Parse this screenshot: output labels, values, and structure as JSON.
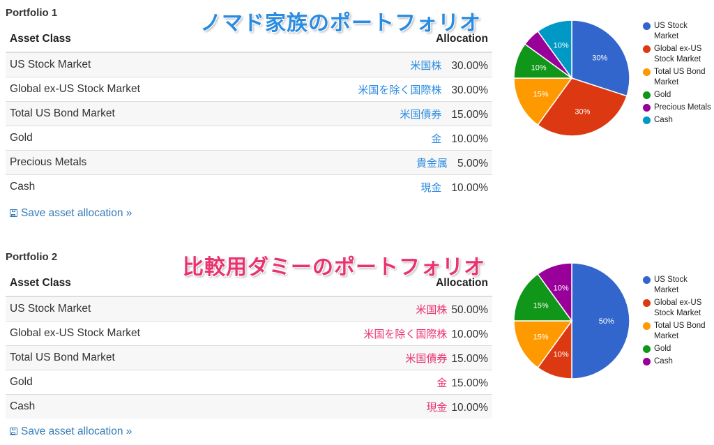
{
  "portfolios": [
    {
      "title": "Portfolio 1",
      "overlay_title": "ノマド家族のポートフォリオ",
      "overlay_color": "#2a8be0",
      "headers": {
        "asset_class": "Asset Class",
        "allocation": "Allocation"
      },
      "rows": [
        {
          "asset": "US Stock Market",
          "jp": "米国株",
          "allocation": "30.00%"
        },
        {
          "asset": "Global ex-US Stock Market",
          "jp": "米国を除く国際株",
          "allocation": "30.00%"
        },
        {
          "asset": "Total US Bond Market",
          "jp": "米国債券",
          "allocation": "15.00%"
        },
        {
          "asset": "Gold",
          "jp": "金",
          "allocation": "10.00%"
        },
        {
          "asset": "Precious Metals",
          "jp": "貴金属",
          "allocation": "5.00%"
        },
        {
          "asset": "Cash",
          "jp": "現金",
          "allocation": "10.00%"
        }
      ],
      "save_label": "Save asset allocation »",
      "save_icon": "floppy-disk-icon"
    },
    {
      "title": "Portfolio 2",
      "overlay_title": "比較用ダミーのポートフォリオ",
      "overlay_color": "#e8336f",
      "headers": {
        "asset_class": "Asset Class",
        "allocation": "Allocation"
      },
      "rows": [
        {
          "asset": "US Stock Market",
          "jp": "米国株",
          "allocation": "50.00%"
        },
        {
          "asset": "Global ex-US Stock Market",
          "jp": "米国を除く国際株",
          "allocation": "10.00%"
        },
        {
          "asset": "Total US Bond Market",
          "jp": "米国債券",
          "allocation": "15.00%"
        },
        {
          "asset": "Gold",
          "jp": "金",
          "allocation": "15.00%"
        },
        {
          "asset": "Cash",
          "jp": "現金",
          "allocation": "10.00%"
        }
      ],
      "save_label": "Save asset allocation »",
      "save_icon": "floppy-disk-icon"
    }
  ],
  "chart_data": [
    {
      "type": "pie",
      "title": "Portfolio 1",
      "legend_position": "right",
      "categories": [
        "US Stock Market",
        "Global ex-US Stock Market",
        "Total US Bond Market",
        "Gold",
        "Precious Metals",
        "Cash"
      ],
      "values": [
        30,
        30,
        15,
        10,
        5,
        10
      ],
      "labels": [
        "30%",
        "30%",
        "15%",
        "10%",
        "",
        "10%"
      ],
      "colors": [
        "#3366cc",
        "#dc3912",
        "#ff9900",
        "#109618",
        "#990099",
        "#0099c6"
      ]
    },
    {
      "type": "pie",
      "title": "Portfolio 2",
      "legend_position": "right",
      "categories": [
        "US Stock Market",
        "Global ex-US Stock Market",
        "Total US Bond Market",
        "Gold",
        "Cash"
      ],
      "values": [
        50,
        10,
        15,
        15,
        10
      ],
      "labels": [
        "50%",
        "10%",
        "15%",
        "15%",
        "10%"
      ],
      "colors": [
        "#3366cc",
        "#dc3912",
        "#ff9900",
        "#109618",
        "#990099"
      ]
    }
  ]
}
